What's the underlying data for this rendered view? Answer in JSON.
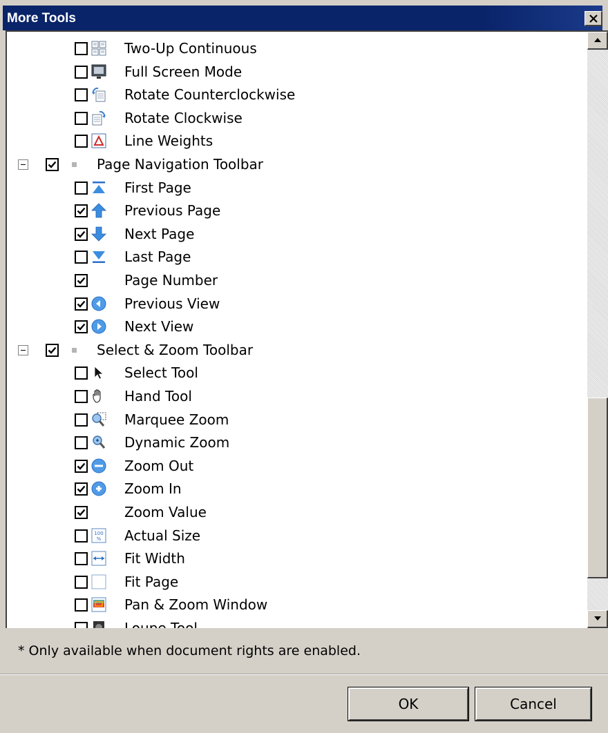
{
  "window": {
    "title": "More Tools"
  },
  "tree": {
    "rows": [
      {
        "kind": "item",
        "label": "Two-Up Continuous",
        "checked": false,
        "icon": "two-up-continuous-icon"
      },
      {
        "kind": "item",
        "label": "Full Screen Mode",
        "checked": false,
        "icon": "full-screen-icon"
      },
      {
        "kind": "item",
        "label": "Rotate Counterclockwise",
        "checked": false,
        "icon": "rotate-ccw-icon"
      },
      {
        "kind": "item",
        "label": "Rotate Clockwise",
        "checked": false,
        "icon": "rotate-cw-icon"
      },
      {
        "kind": "item",
        "label": "Line Weights",
        "checked": false,
        "icon": "line-weights-icon"
      },
      {
        "kind": "group",
        "label": "Page Navigation Toolbar",
        "checked": true,
        "expanded": true
      },
      {
        "kind": "item",
        "label": "First Page",
        "checked": false,
        "icon": "first-page-icon"
      },
      {
        "kind": "item",
        "label": "Previous Page",
        "checked": true,
        "icon": "previous-page-icon"
      },
      {
        "kind": "item",
        "label": "Next Page",
        "checked": true,
        "icon": "next-page-icon"
      },
      {
        "kind": "item",
        "label": "Last Page",
        "checked": false,
        "icon": "last-page-icon"
      },
      {
        "kind": "item",
        "label": "Page Number",
        "checked": true,
        "icon": ""
      },
      {
        "kind": "item",
        "label": "Previous View",
        "checked": true,
        "icon": "previous-view-icon"
      },
      {
        "kind": "item",
        "label": "Next View",
        "checked": true,
        "icon": "next-view-icon"
      },
      {
        "kind": "group",
        "label": "Select & Zoom Toolbar",
        "checked": true,
        "expanded": true
      },
      {
        "kind": "item",
        "label": "Select Tool",
        "checked": false,
        "icon": "select-arrow-icon"
      },
      {
        "kind": "item",
        "label": "Hand Tool",
        "checked": false,
        "icon": "hand-icon"
      },
      {
        "kind": "item",
        "label": "Marquee Zoom",
        "checked": false,
        "icon": "marquee-zoom-icon"
      },
      {
        "kind": "item",
        "label": "Dynamic Zoom",
        "checked": false,
        "icon": "dynamic-zoom-icon"
      },
      {
        "kind": "item",
        "label": "Zoom Out",
        "checked": true,
        "icon": "zoom-out-icon"
      },
      {
        "kind": "item",
        "label": "Zoom In",
        "checked": true,
        "icon": "zoom-in-icon"
      },
      {
        "kind": "item",
        "label": "Zoom Value",
        "checked": true,
        "icon": ""
      },
      {
        "kind": "item",
        "label": "Actual Size",
        "checked": false,
        "icon": "actual-size-icon"
      },
      {
        "kind": "item",
        "label": "Fit Width",
        "checked": false,
        "icon": "fit-width-icon"
      },
      {
        "kind": "item",
        "label": "Fit Page",
        "checked": false,
        "icon": "fit-page-icon"
      },
      {
        "kind": "item",
        "label": "Pan & Zoom Window",
        "checked": false,
        "icon": "pan-zoom-window-icon"
      },
      {
        "kind": "item",
        "label": "Loupe Tool",
        "checked": false,
        "icon": "loupe-icon"
      }
    ]
  },
  "footer": {
    "note": "* Only available when document rights are enabled.",
    "ok_label": "OK",
    "cancel_label": "Cancel"
  },
  "colors": {
    "title_bar": "#0a246a",
    "dialog_face": "#d4d0c8",
    "list_background": "#ffffff",
    "nav_arrow_blue": "#3b8de0"
  }
}
